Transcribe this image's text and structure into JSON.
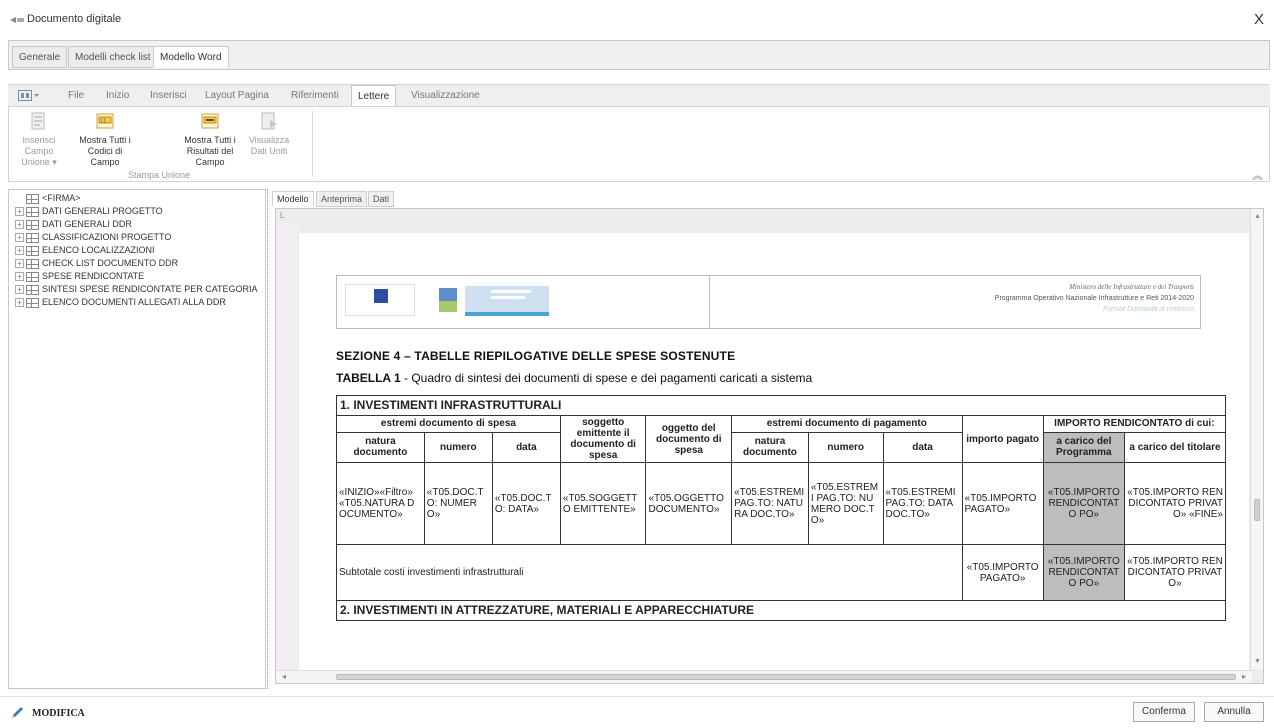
{
  "window": {
    "title": "Documento digitale",
    "close_label": "X"
  },
  "top_tabs": [
    {
      "label": "Generale"
    },
    {
      "label": "Modelli check list"
    },
    {
      "label": "Modello Word"
    }
  ],
  "ribbon": {
    "menu_label": "File",
    "tabs": [
      "Inizio",
      "Inserisci",
      "Layout Pagina",
      "Riferimenti",
      "Lettere",
      "Visualizzazione"
    ],
    "active_tab": "Lettere",
    "buttons": [
      {
        "label": "Inserisci Campo Unione ▾",
        "enabled": false
      },
      {
        "label": "Mostra Tutti i Codici di Campo",
        "enabled": true
      },
      {
        "label": "Mostra Tutti i Risultati del Campo",
        "enabled": true
      },
      {
        "label": "Visualizza Dati Uniti",
        "enabled": false
      }
    ],
    "group_label": "Stampa Unione",
    "collapse_glyph": "︽"
  },
  "tree": {
    "items": [
      {
        "label": "<FIRMA>"
      },
      {
        "label": "DATI GENERALI PROGETTO"
      },
      {
        "label": "DATI GENERALI DDR"
      },
      {
        "label": "CLASSIFICAZIONI PROGETTO"
      },
      {
        "label": "ELENCO LOCALIZZAZIONI"
      },
      {
        "label": "CHECK LIST DOCUMENTO DDR"
      },
      {
        "label": "SPESE RENDICONTATE"
      },
      {
        "label": "SINTESI SPESE RENDICONTATE PER CATEGORIA"
      },
      {
        "label": "ELENCO DOCUMENTI ALLEGATI ALLA DDR"
      }
    ]
  },
  "editor_tabs": [
    {
      "label": "Modello"
    },
    {
      "label": "Anteprima"
    },
    {
      "label": "Dati"
    }
  ],
  "document": {
    "ruler_corner": "L",
    "header_right": {
      "line1": "Ministero delle Infrastrutture e dei Trasporti",
      "line2": "Programma Operativo Nazionale Infrastrutture e Reti 2014-2020",
      "line3": "Format Domanda di rimborso"
    },
    "section_title": "SEZIONE 4 – TABELLE RIEPILOGATIVE DELLE SPESE SOSTENUTE",
    "table_title_bold": "TABELLA 1",
    "table_title_rest": " - Quadro di sintesi dei documenti di spese e dei pagamenti caricati a sistema",
    "table": {
      "section1": "1. INVESTIMENTI INFRASTRUTTURALI",
      "h_estremi_spesa": "estremi documento di spesa",
      "h_soggetto": "soggetto emittente il documento di spesa",
      "h_oggetto": "oggetto del documento di spesa",
      "h_estremi_pag": "estremi documento di pagamento",
      "h_importo": "importo pagato",
      "h_importo_rend": "IMPORTO RENDICONTATO di cui:",
      "sh_natura": "natura documento",
      "sh_numero": "numero",
      "sh_data": "data",
      "sh_natura2": "natura documento",
      "sh_numero2": "numero",
      "sh_data2": "data",
      "sh_carico_prog": "a carico del Programma",
      "sh_carico_tit": "a carico del titolare",
      "row": {
        "natura": "«INIZIO»«Filtro» «T05.NATURA DOCUMENTO»",
        "numero": "«T05.DOC.TO: NUMERO»",
        "data": "«T05.DOC.TO: DATA»",
        "soggetto": "«T05.SOGGETTO EMITTENTE»",
        "oggetto": "«T05.OGGETTO DOCUMENTO»",
        "natura_pag": "«T05.ESTREMI PAG.TO: NATURA DOC.TO»",
        "numero_pag": "«T05.ESTREMI PAG.TO: NUMERO DOC.TO»",
        "data_pag": "«T05.ESTREMI PAG.TO: DATA DOC.TO»",
        "importo": "«T05.IMPORTO PAGATO»",
        "rend_po": "«T05.IMPORTO RENDICONTATO PO»",
        "rend_priv": "«T05.IMPORTO RENDICONTATO PRIVATO» «FINE»"
      },
      "subtotal_label": "Subtotale costi investimenti infrastrutturali",
      "subtotal_importo": "«T05.IMPORTO PAGATO»",
      "subtotal_po": "«T05.IMPORTO RENDICONTATO PO»",
      "subtotal_priv": "«T05.IMPORTO RENDICONTATO PRIVATO»",
      "section2": "2. INVESTIMENTI IN ATTREZZATURE, MATERIALI E APPARECCHIATURE"
    }
  },
  "status": {
    "mode": "MODIFICA"
  },
  "buttons": {
    "confirm": "Conferma",
    "cancel": "Annulla"
  }
}
